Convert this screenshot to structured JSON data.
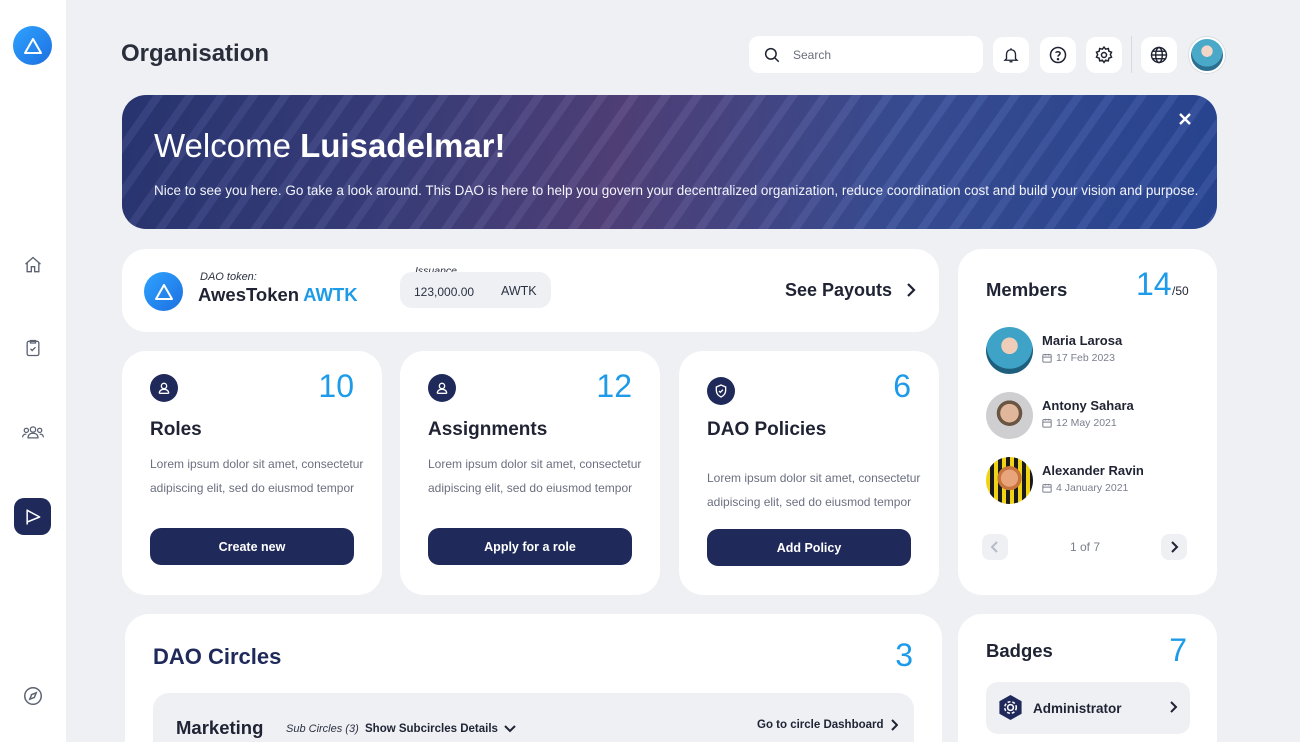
{
  "page": {
    "title": "Organisation"
  },
  "header": {
    "search_placeholder": "Search"
  },
  "banner": {
    "greeting": "Welcome",
    "user_name": "Luisadelmar!",
    "message": "Nice to see you here. Go take a look around. This DAO is here to help you govern your decentralized organization, reduce coordination cost and build your vision and purpose."
  },
  "token": {
    "label": "DAO token:",
    "name": "AwesToken",
    "symbol": "AWTK",
    "issuance_label": "Issuance",
    "issuance_amount": "123,000.00",
    "issuance_currency": "AWTK",
    "payouts_label": "See Payouts"
  },
  "stats": [
    {
      "title": "Roles",
      "count": "10",
      "description": "Lorem ipsum dolor sit amet, consectetur adipiscing elit, sed do eiusmod tempor",
      "button": "Create new",
      "icon": "user-icon"
    },
    {
      "title": "Assignments",
      "count": "12",
      "description": "Lorem ipsum dolor sit amet, consectetur adipiscing elit, sed do eiusmod tempor",
      "button": "Apply for a role",
      "icon": "user-icon"
    },
    {
      "title": "DAO Policies",
      "count": "6",
      "description": "Lorem ipsum dolor sit amet, consectetur adipiscing elit, sed do eiusmod tempor",
      "button": "Add Policy",
      "icon": "shield-check-icon"
    }
  ],
  "members": {
    "title": "Members",
    "count": "14",
    "total": "/50",
    "list": [
      {
        "name": "Maria Larosa",
        "date": "17 Feb 2023"
      },
      {
        "name": "Antony Sahara",
        "date": "12 May 2021"
      },
      {
        "name": "Alexander Ravin",
        "date": "4 January 2021"
      }
    ],
    "pager": "1 of 7"
  },
  "circles": {
    "title": "DAO Circles",
    "count": "3",
    "items": [
      {
        "name": "Marketing",
        "sub_circles": "Sub Circles (3)",
        "show_details": "Show Subcircles Details",
        "dashboard_link": "Go to circle Dashboard"
      }
    ]
  },
  "badges": {
    "title": "Badges",
    "count": "7",
    "items": [
      {
        "label": "Administrator"
      }
    ]
  },
  "colors": {
    "accent": "#1e9be8",
    "navy": "#1f2a5a",
    "background": "#eef0f4"
  }
}
